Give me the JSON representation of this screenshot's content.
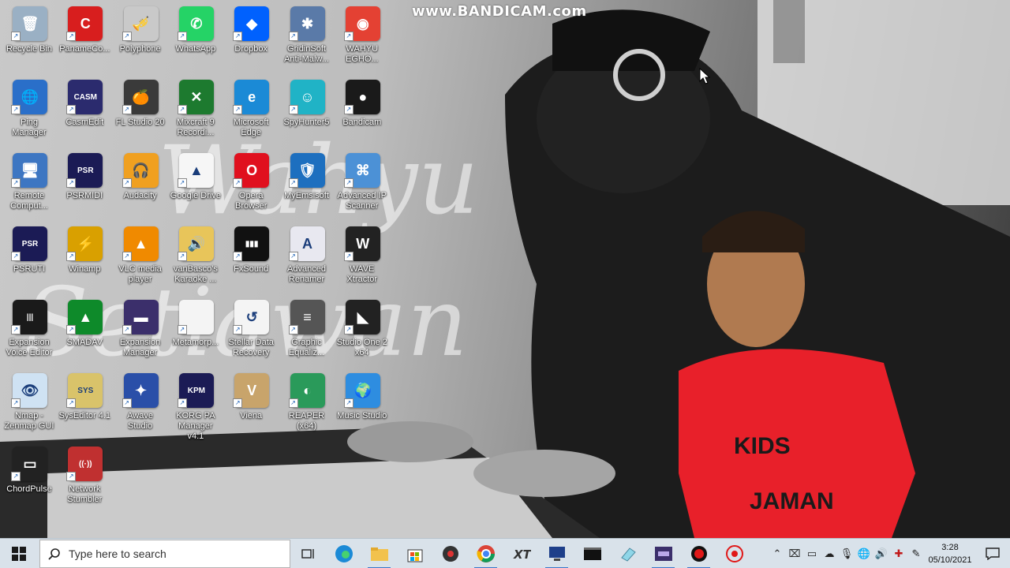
{
  "watermark": "www.BANDICAM.com",
  "wallpaper": {
    "script_line1": "Wahyu",
    "script_line2": "Setiawan",
    "shirt_text1": "KIDS",
    "shirt_text2": "JAMAN"
  },
  "desktop_icons": [
    {
      "label": "Recycle Bin",
      "color": "#9ab0c4",
      "glyph": "🗑"
    },
    {
      "label": "PanameCo...",
      "color": "#d81e1e",
      "glyph": "C"
    },
    {
      "label": "Polyphone",
      "color": "#c9c9c9",
      "glyph": "🎺"
    },
    {
      "label": "WhatsApp",
      "color": "#25d366",
      "glyph": "✆"
    },
    {
      "label": "Dropbox",
      "color": "#0061fe",
      "glyph": "◆"
    },
    {
      "label": "GridinSoft Anti-Malw...",
      "color": "#5a7aa8",
      "glyph": "✱"
    },
    {
      "label": "WAHYU EGHO...",
      "color": "#e44133",
      "glyph": "◉"
    },
    {
      "label": "Ping Manager",
      "color": "#2a6fc9",
      "glyph": "🌐"
    },
    {
      "label": "CasmEdit",
      "color": "#2b2b6e",
      "glyph": "CASM"
    },
    {
      "label": "FL Studio 20",
      "color": "#3a3a3a",
      "glyph": "🍊"
    },
    {
      "label": "Mixcraft 9 Recordi...",
      "color": "#1d7a2f",
      "glyph": "✕"
    },
    {
      "label": "Microsoft Edge",
      "color": "#1b8ad6",
      "glyph": "e"
    },
    {
      "label": "SpyHunter5",
      "color": "#20b3c6",
      "glyph": "☺"
    },
    {
      "label": "Bandicam",
      "color": "#1a1a1a",
      "glyph": "●"
    },
    {
      "label": "Remote Comput...",
      "color": "#3d76c2",
      "glyph": "🖥"
    },
    {
      "label": "PSRMIDI",
      "color": "#1b1b55",
      "glyph": "PSR"
    },
    {
      "label": "Audacity",
      "color": "#f0a020",
      "glyph": "🎧"
    },
    {
      "label": "Google Drive",
      "color": "#f6f6f6",
      "glyph": "▲"
    },
    {
      "label": "Opera Browser",
      "color": "#e0101e",
      "glyph": "O"
    },
    {
      "label": "MyEmsisoft",
      "color": "#1d6fbf",
      "glyph": "🛡"
    },
    {
      "label": "Advanced IP Scanner",
      "color": "#4c91d6",
      "glyph": "⌘"
    },
    {
      "label": "PSRUTI",
      "color": "#1b1b55",
      "glyph": "PSR"
    },
    {
      "label": "Winamp",
      "color": "#d9a000",
      "glyph": "⚡"
    },
    {
      "label": "VLC media player",
      "color": "#f08a00",
      "glyph": "▲"
    },
    {
      "label": "vanBasco's Karaoke ...",
      "color": "#e8c55a",
      "glyph": "🔊"
    },
    {
      "label": "FxSound",
      "color": "#111111",
      "glyph": "▮▮▮"
    },
    {
      "label": "Advanced Renamer",
      "color": "#e8e8f0",
      "glyph": "A"
    },
    {
      "label": "WAVE Xtractor",
      "color": "#222222",
      "glyph": "W"
    },
    {
      "label": "Expansion Voice Editor",
      "color": "#1a1a1a",
      "glyph": "|||"
    },
    {
      "label": "SMADAV",
      "color": "#0e8a2a",
      "glyph": "▲"
    },
    {
      "label": "Expansion Manager",
      "color": "#3b2f6b",
      "glyph": "▬"
    },
    {
      "label": "Metamorp...",
      "color": "#f4f4f4",
      "glyph": ""
    },
    {
      "label": "Stellar Data Recovery",
      "color": "#f4f4f4",
      "glyph": "↺"
    },
    {
      "label": "Graphic Equaliz...",
      "color": "#555",
      "glyph": "≡"
    },
    {
      "label": "Studio One 2 x64",
      "color": "#222",
      "glyph": "◣"
    },
    {
      "label": "Nmap - Zenmap GUI",
      "color": "#cfe2f3",
      "glyph": "👁"
    },
    {
      "label": "SysEditor 4.1",
      "color": "#d9c36a",
      "glyph": "SYS"
    },
    {
      "label": "Awave Studio",
      "color": "#2a4fa8",
      "glyph": "✦"
    },
    {
      "label": "KORG PA Manager v4.1",
      "color": "#1b1b55",
      "glyph": "KPM"
    },
    {
      "label": "Viena",
      "color": "#c8a46b",
      "glyph": "V"
    },
    {
      "label": "REAPER (x64)",
      "color": "#2a9a5a",
      "glyph": "◐"
    },
    {
      "label": "Music Studio",
      "color": "#2e8de0",
      "glyph": "🌍"
    },
    {
      "label": "ChordPulse",
      "color": "#222",
      "glyph": "▭"
    },
    {
      "label": "Network Stumbler",
      "color": "#c03030",
      "glyph": "((·))"
    }
  ],
  "taskbar": {
    "search_placeholder": "Type here to search",
    "apps": [
      {
        "name": "task-view"
      },
      {
        "name": "edge"
      },
      {
        "name": "file-explorer"
      },
      {
        "name": "store"
      },
      {
        "name": "media-player"
      },
      {
        "name": "chrome"
      },
      {
        "name": "xt-app"
      },
      {
        "name": "remote-desktop"
      },
      {
        "name": "terminal"
      },
      {
        "name": "eraser-app"
      },
      {
        "name": "expansion-manager"
      },
      {
        "name": "bandicam-record"
      },
      {
        "name": "bandicam-target"
      }
    ],
    "clock_time": "3:28",
    "clock_date": "05/10/2021"
  }
}
